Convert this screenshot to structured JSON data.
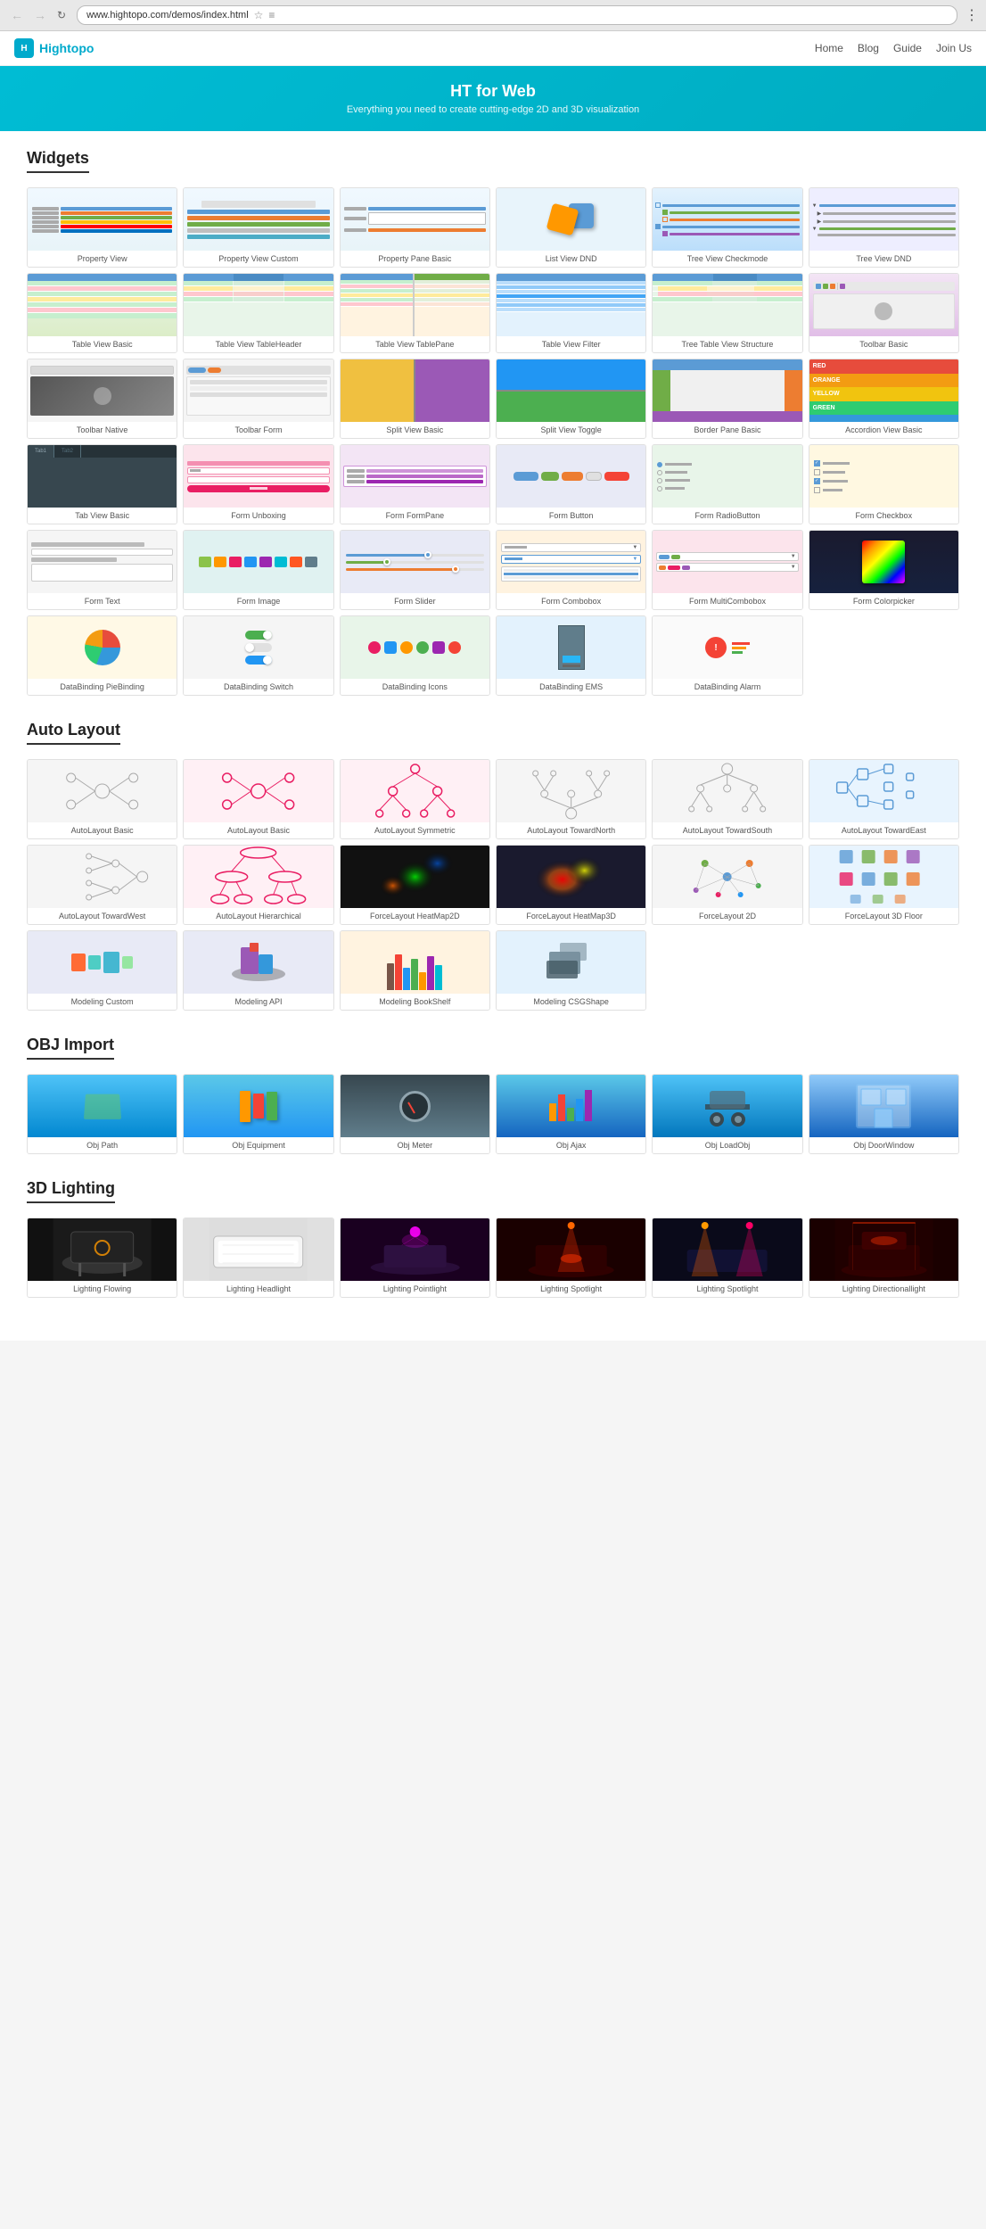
{
  "browser": {
    "url": "www.hightopo.com/demos/index.html",
    "back_disabled": true,
    "forward_disabled": true
  },
  "topnav": {
    "logo": "Hightopo",
    "links": [
      "Home",
      "Blog",
      "Guide",
      "Join Us"
    ]
  },
  "hero": {
    "title": "HT for Web",
    "subtitle": "Everything you need to create cutting-edge 2D and 3D visualization"
  },
  "sections": [
    {
      "id": "widgets",
      "title": "Widgets",
      "demos": [
        {
          "label": "Property View",
          "thumb": "property"
        },
        {
          "label": "Property View Custom",
          "thumb": "property"
        },
        {
          "label": "Property Pane Basic",
          "thumb": "property"
        },
        {
          "label": "List View DND",
          "thumb": "tree"
        },
        {
          "label": "Tree View Checkmode",
          "thumb": "tree"
        },
        {
          "label": "Tree View DND",
          "thumb": "tree"
        },
        {
          "label": "Table View Basic",
          "thumb": "table"
        },
        {
          "label": "Table View TableHeader",
          "thumb": "table"
        },
        {
          "label": "Table View TablePane",
          "thumb": "table"
        },
        {
          "label": "Table View Filter",
          "thumb": "table"
        },
        {
          "label": "Tree Table View Structure",
          "thumb": "tree"
        },
        {
          "label": "Toolbar Basic",
          "thumb": "toolbar"
        },
        {
          "label": "Toolbar Native",
          "thumb": "toolbar"
        },
        {
          "label": "Toolbar Form",
          "thumb": "toolbar"
        },
        {
          "label": "Split View Basic",
          "thumb": "split"
        },
        {
          "label": "Split View Toggle",
          "thumb": "split"
        },
        {
          "label": "Border Pane Basic",
          "thumb": "split"
        },
        {
          "label": "Accordion View Basic",
          "thumb": "accordion"
        },
        {
          "label": "Tab View Basic",
          "thumb": "tab"
        },
        {
          "label": "Form Unboxing",
          "thumb": "form"
        },
        {
          "label": "Form FormPane",
          "thumb": "form"
        },
        {
          "label": "Form Button",
          "thumb": "form"
        },
        {
          "label": "Form RadioButton",
          "thumb": "form"
        },
        {
          "label": "Form Checkbox",
          "thumb": "form"
        },
        {
          "label": "Form Text",
          "thumb": "form"
        },
        {
          "label": "Form Image",
          "thumb": "form"
        },
        {
          "label": "Form Slider",
          "thumb": "form"
        },
        {
          "label": "Form Combobox",
          "thumb": "form"
        },
        {
          "label": "Form MultiCombobox",
          "thumb": "form"
        },
        {
          "label": "Form Colorpicker",
          "thumb": "colorpicker"
        },
        {
          "label": "DataBinding PieBinding",
          "thumb": "pie"
        },
        {
          "label": "DataBinding Switch",
          "thumb": "data"
        },
        {
          "label": "DataBinding Icons",
          "thumb": "data"
        },
        {
          "label": "DataBinding EMS",
          "thumb": "data"
        },
        {
          "label": "DataBinding Alarm",
          "thumb": "data"
        }
      ]
    },
    {
      "id": "autolayout",
      "title": "Auto Layout",
      "demos": [
        {
          "label": "AutoLayout Basic",
          "thumb": "autolayout"
        },
        {
          "label": "AutoLayout Basic",
          "thumb": "autolayout-pink"
        },
        {
          "label": "AutoLayout Symmetric",
          "thumb": "autolayout-pink"
        },
        {
          "label": "AutoLayout TowardNorth",
          "thumb": "autolayout"
        },
        {
          "label": "AutoLayout TowardSouth",
          "thumb": "autolayout"
        },
        {
          "label": "AutoLayout TowardEast",
          "thumb": "autolayout"
        },
        {
          "label": "AutoLayout TowardWest",
          "thumb": "autolayout"
        },
        {
          "label": "AutoLayout Hierarchical",
          "thumb": "autolayout-pink"
        },
        {
          "label": "ForceLayout HeatMap2D",
          "thumb": "force-heat"
        },
        {
          "label": "ForceLayout HeatMap3D",
          "thumb": "force-heat3d"
        },
        {
          "label": "ForceLayout 2D",
          "thumb": "autolayout"
        },
        {
          "label": "ForceLayout 3D Floor",
          "thumb": "force-floor"
        },
        {
          "label": "Modeling Custom",
          "thumb": "modeling"
        },
        {
          "label": "Modeling API",
          "thumb": "modeling"
        },
        {
          "label": "Modeling BookShelf",
          "thumb": "modeling"
        },
        {
          "label": "Modeling CSGShape",
          "thumb": "modeling"
        }
      ]
    },
    {
      "id": "obj",
      "title": "OBJ Import",
      "demos": [
        {
          "label": "Obj Path",
          "thumb": "obj"
        },
        {
          "label": "Obj Equipment",
          "thumb": "obj"
        },
        {
          "label": "Obj Meter",
          "thumb": "obj"
        },
        {
          "label": "Obj Ajax",
          "thumb": "obj"
        },
        {
          "label": "Obj LoadObj",
          "thumb": "obj"
        },
        {
          "label": "Obj DoorWindow",
          "thumb": "obj-room"
        }
      ]
    },
    {
      "id": "lighting",
      "title": "3D Lighting",
      "demos": [
        {
          "label": "Lighting Flowing",
          "thumb": "lighting-dark"
        },
        {
          "label": "Lighting Headlight",
          "thumb": "lighting-white"
        },
        {
          "label": "Lighting Pointlight",
          "thumb": "lighting-pink"
        },
        {
          "label": "Lighting Spotlight",
          "thumb": "lighting-red"
        },
        {
          "label": "Lighting Spotlight",
          "thumb": "lighting-dark2"
        },
        {
          "label": "Lighting Directionallight",
          "thumb": "lighting-red2"
        }
      ]
    }
  ]
}
